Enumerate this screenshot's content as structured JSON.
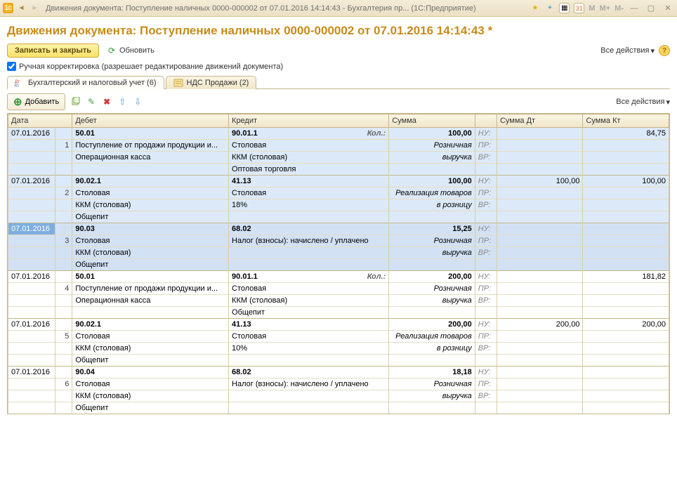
{
  "titlebar": {
    "text": "Движения документа: Поступление наличных 0000-000002 от 07.01.2016 14:14:43 - Бухгалтерия пр...   (1С:Предприятие)",
    "calc_m": "M",
    "calc_mp": "M+",
    "calc_mm": "M-"
  },
  "heading": "Движения документа: Поступление наличных 0000-000002 от 07.01.2016 14:14:43 *",
  "toolbar": {
    "save_close": "Записать и закрыть",
    "refresh": "Обновить",
    "all_actions": "Все действия"
  },
  "manual_edit": {
    "label": "Ручная корректировка (разрешает редактирование движений документа)",
    "checked": true
  },
  "tabs": {
    "t1": "Бухгалтерский и налоговый учет (6)",
    "t2": "НДС Продажи (2)"
  },
  "subtoolbar": {
    "add": "Добавить",
    "all_actions": "Все действия"
  },
  "columns": {
    "date": "Дата",
    "debit": "Дебет",
    "credit": "Кредит",
    "sum": "Сумма",
    "sum_dt": "Сумма Дт",
    "sum_kt": "Сумма Кт"
  },
  "labels": {
    "kol": "Кол.:",
    "nu": "НУ:",
    "pr": "ПР:",
    "vr": "ВР:"
  },
  "rows": [
    {
      "n": 1,
      "date": "07.01.2016",
      "selected": true,
      "debit_acc": "50.01",
      "debit_lines": [
        "Поступление от продажи продукции и...",
        "Операционная касса"
      ],
      "credit_acc": "90.01.1",
      "credit_kol": true,
      "credit_lines": [
        "Столовая",
        "ККМ (столовая)",
        "Оптовая торговля"
      ],
      "sum": "100,00",
      "sum_note": "Розничная выручка",
      "sum_dt": "",
      "sum_kt": "84,75"
    },
    {
      "n": 2,
      "date": "07.01.2016",
      "selected": true,
      "debit_acc": "90.02.1",
      "debit_lines": [
        "Столовая",
        "ККМ (столовая)",
        "Общепит"
      ],
      "credit_acc": "41.13",
      "credit_lines": [
        "Столовая",
        "18%"
      ],
      "sum": "100,00",
      "sum_note": "Реализация товаров в розницу",
      "sum_dt": "100,00",
      "sum_kt": "100,00"
    },
    {
      "n": 3,
      "date": "07.01.2016",
      "selected": "strong",
      "debit_acc": "90.03",
      "debit_lines": [
        "Столовая",
        "ККМ (столовая)",
        "Общепит"
      ],
      "credit_acc": "68.02",
      "credit_lines": [
        "Налог (взносы): начислено / уплачено"
      ],
      "sum": "15,25",
      "sum_note": "Розничная выручка",
      "sum_dt": "",
      "sum_kt": ""
    },
    {
      "n": 4,
      "date": "07.01.2016",
      "selected": false,
      "debit_acc": "50.01",
      "debit_lines": [
        "Поступление от продажи продукции и...",
        "Операционная касса"
      ],
      "credit_acc": "90.01.1",
      "credit_kol": true,
      "credit_lines": [
        "Столовая",
        "ККМ (столовая)",
        "Общепит"
      ],
      "sum": "200,00",
      "sum_note": "Розничная выручка",
      "sum_dt": "",
      "sum_kt": "181,82"
    },
    {
      "n": 5,
      "date": "07.01.2016",
      "selected": false,
      "debit_acc": "90.02.1",
      "debit_lines": [
        "Столовая",
        "ККМ (столовая)",
        "Общепит"
      ],
      "credit_acc": "41.13",
      "credit_lines": [
        "Столовая",
        "10%"
      ],
      "sum": "200,00",
      "sum_note": "Реализация товаров в розницу",
      "sum_dt": "200,00",
      "sum_kt": "200,00"
    },
    {
      "n": 6,
      "date": "07.01.2016",
      "selected": false,
      "debit_acc": "90.04",
      "debit_lines": [
        "Столовая",
        "ККМ (столовая)",
        "Общепит"
      ],
      "credit_acc": "68.02",
      "credit_lines": [
        "Налог (взносы): начислено / уплачено"
      ],
      "sum": "18,18",
      "sum_note": "Розничная выручка",
      "sum_dt": "",
      "sum_kt": ""
    }
  ]
}
